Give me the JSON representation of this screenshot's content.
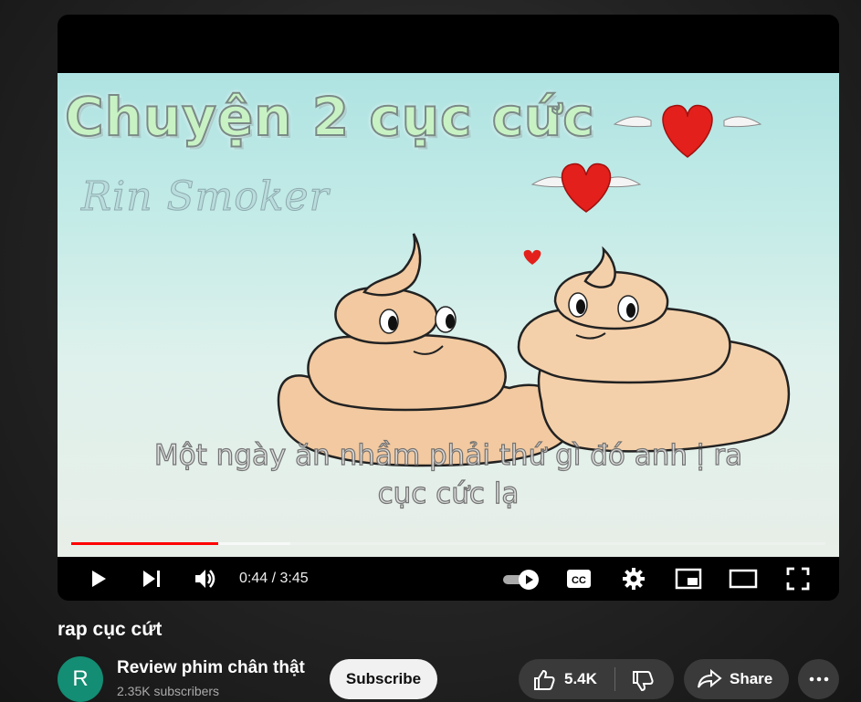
{
  "player": {
    "video_title_art": "Chuyện 2 cục cức",
    "video_author_art": "Rin Smoker",
    "subtitle_line1": "Một ngày ăn nhầm phải thứ gì đó anh ị ra",
    "subtitle_line2": "cục cức lạ",
    "time_display": "0:44 / 3:45",
    "progress_played_fraction": 0.195,
    "progress_buffered_fraction": 0.29,
    "accent_color": "#ff0000",
    "controls": [
      "play-icon",
      "next-icon",
      "volume-icon",
      "autoplay-toggle",
      "captions-icon",
      "settings-icon",
      "miniplayer-icon",
      "theater-icon",
      "fullscreen-icon"
    ]
  },
  "video": {
    "title": "rap cục cứt"
  },
  "channel": {
    "avatar_letter": "R",
    "avatar_color": "#138d73",
    "name": "Review phim chân thật",
    "subscribers": "2.35K subscribers"
  },
  "actions": {
    "subscribe_label": "Subscribe",
    "like_count": "5.4K",
    "share_label": "Share"
  }
}
